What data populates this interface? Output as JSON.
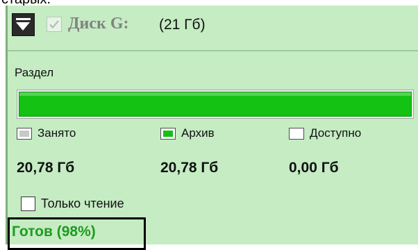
{
  "top_cut_text": "старых.",
  "header": {
    "collapse_icon": "collapse-toggle-icon",
    "disk_checked": true,
    "disk_title": "Диск G:",
    "disk_size": "(21 Гб)"
  },
  "partition": {
    "label": "Раздел",
    "fill_fraction": 1.0,
    "fill_color": "#13c213"
  },
  "legend": {
    "used_label": "Занято",
    "archive_label": "Архив",
    "free_label": "Доступно",
    "used_color": "#c8c8c8",
    "archive_color": "#13c213",
    "free_color": "#ffffff"
  },
  "values": {
    "used": "20,78 Гб",
    "archive": "20,78 Гб",
    "free": "0,00 Гб"
  },
  "read_only": {
    "label": "Только чтение",
    "checked": false
  },
  "status": {
    "text": "Готов (98%)",
    "color": "#1f9a1f"
  }
}
